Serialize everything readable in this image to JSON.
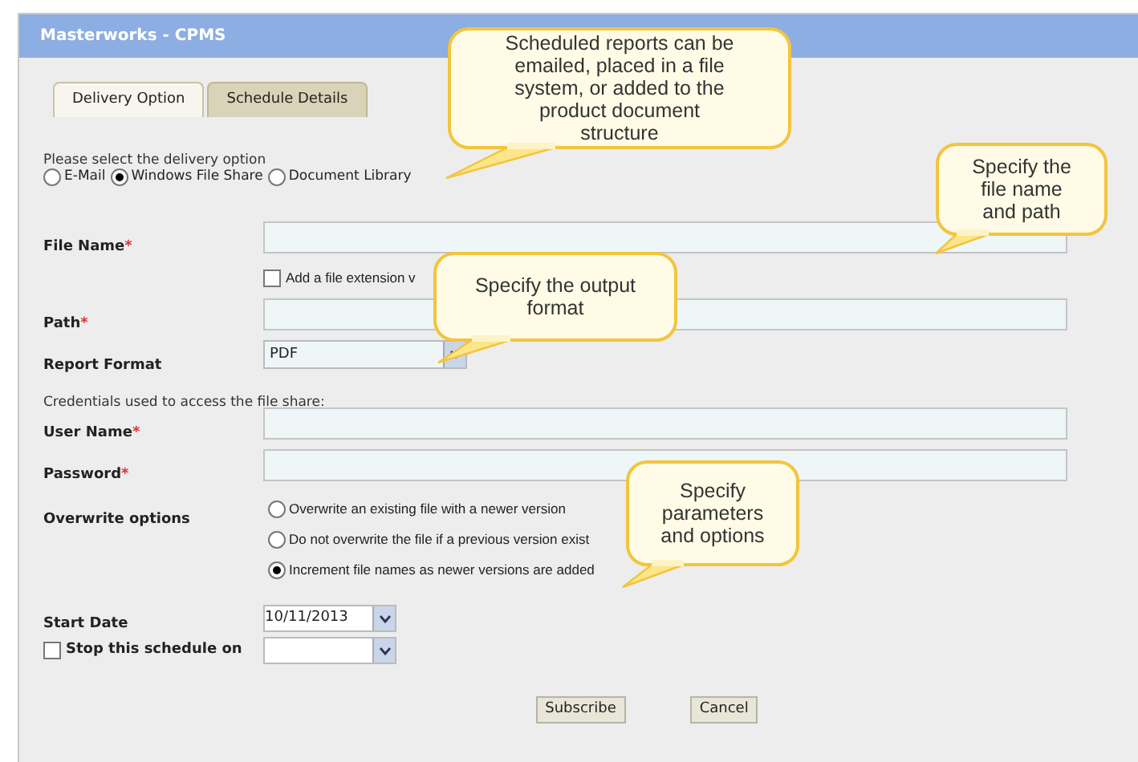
{
  "window": {
    "title": "Masterworks - CPMS"
  },
  "tabs": [
    {
      "label": "Delivery Option",
      "selected": true
    },
    {
      "label": "Schedule Details",
      "selected": false
    }
  ],
  "delivery": {
    "prompt": "Please select the delivery option",
    "options": [
      {
        "label": "E-Mail",
        "selected": false
      },
      {
        "label": "Windows File Share",
        "selected": true
      },
      {
        "label": "Document Library",
        "selected": false
      }
    ]
  },
  "fields": [
    {
      "kind": "text",
      "label": "File Name",
      "required_mark": "*"
    },
    {
      "kind": "checkbox",
      "label": "Add a file extension v",
      "checked": false
    },
    {
      "kind": "text",
      "label": "Path",
      "required_mark": "*"
    },
    {
      "kind": "select",
      "label": "Report Format",
      "value": "PDF"
    },
    {
      "kind": "note",
      "label": "Credentials used to access the file share:"
    },
    {
      "kind": "text",
      "label": "User Name",
      "required_mark": "*"
    },
    {
      "kind": "text",
      "label": "Password",
      "required_mark": "*"
    },
    {
      "kind": "radios",
      "label": "Overwrite options",
      "options": [
        {
          "label": "Overwrite an existing file with a newer version",
          "selected": false
        },
        {
          "label": "Do not overwrite the file if a previous version exist",
          "selected": false
        },
        {
          "label": "Increment file names as newer versions are added",
          "selected": true
        }
      ]
    }
  ],
  "schedule": {
    "start": {
      "label": "Start Date",
      "value": "10/11/2013"
    },
    "stop": {
      "label": "Stop this schedule on",
      "checked": false
    }
  },
  "buttons": [
    "Subscribe",
    "Cancel"
  ],
  "callouts": [
    "Scheduled reports can be emailed, placed in a file system, or added to the product document structure",
    "Specify the file name and path",
    "Specify the output format",
    "Specify parameters and options"
  ]
}
